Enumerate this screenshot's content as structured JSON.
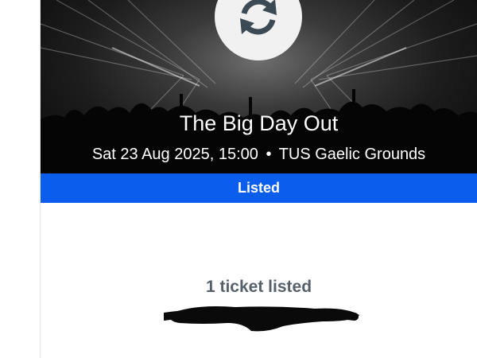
{
  "event": {
    "title": "The Big Day Out",
    "date_time": "Sat 23 Aug 2025, 15:00",
    "separator": "•",
    "venue": "TUS Gaelic Grounds",
    "icon": "refresh-icon"
  },
  "status": {
    "label": "Listed",
    "color": "#0b5ded"
  },
  "listing": {
    "tickets_text": "1 ticket listed"
  }
}
